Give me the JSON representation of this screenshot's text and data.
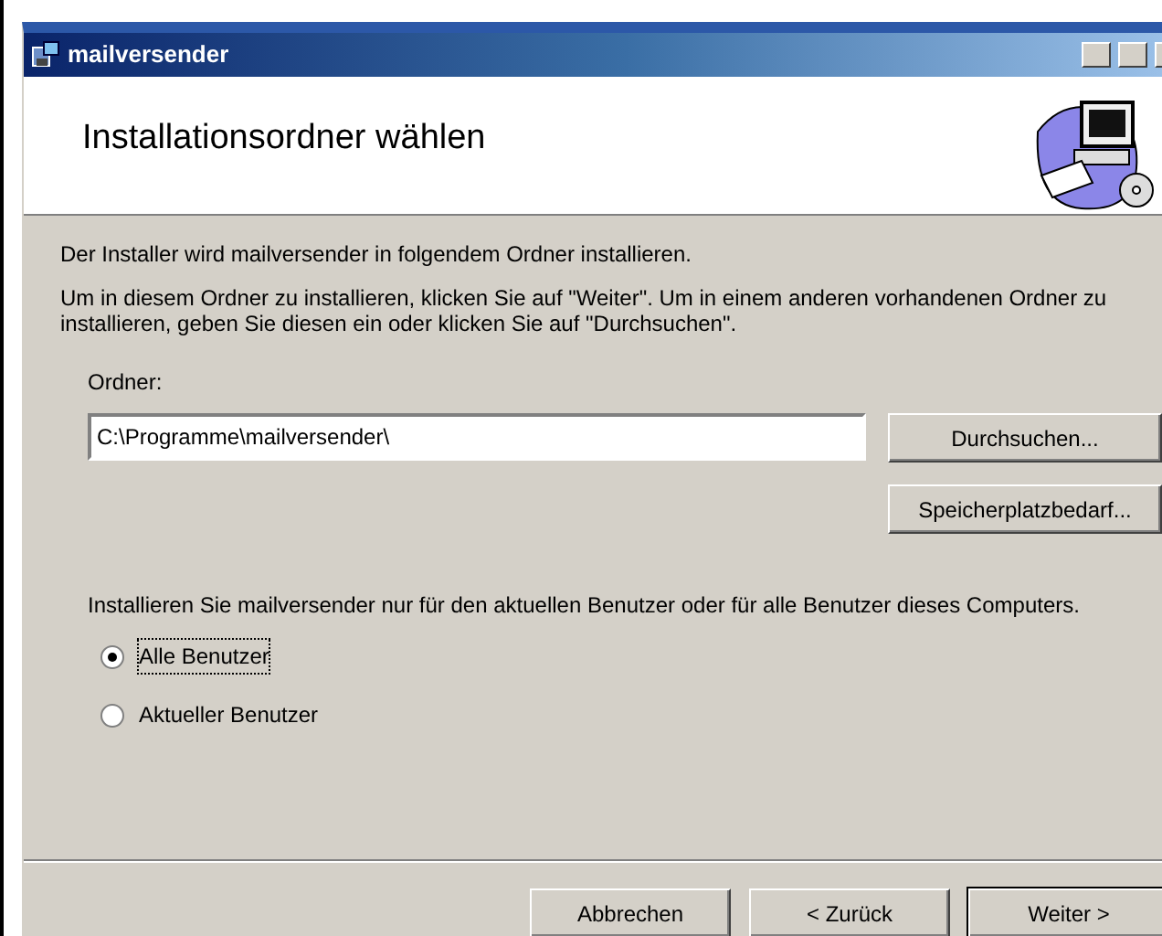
{
  "window": {
    "title": "mailversender"
  },
  "header": {
    "title": "Installationsordner wählen"
  },
  "intro": "Der Installer wird mailversender in folgendem Ordner installieren.",
  "instructions": "Um in diesem Ordner zu installieren, klicken Sie auf \"Weiter\". Um in einem anderen vorhandenen Ordner zu installieren, geben Sie diesen ein oder klicken Sie auf \"Durchsuchen\".",
  "folder": {
    "label": "Ordner:",
    "value": "C:\\Programme\\mailversender\\"
  },
  "side_buttons": [
    "Durchsuchen...",
    "Speicherplatzbedarf..."
  ],
  "scope": {
    "text": "Installieren Sie mailversender nur für den aktuellen Benutzer oder für alle Benutzer dieses Computers.",
    "options": [
      {
        "label": "Alle Benutzer",
        "selected": true
      },
      {
        "label": "Aktueller Benutzer",
        "selected": false
      }
    ]
  },
  "buttons": [
    {
      "label": "Abbrechen",
      "default": false
    },
    {
      "label": "< Zurück",
      "default": false
    },
    {
      "label": "Weiter >",
      "default": true
    }
  ]
}
